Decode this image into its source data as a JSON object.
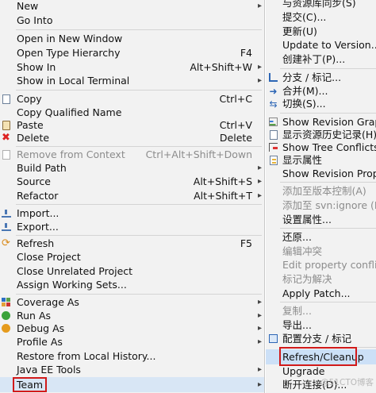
{
  "main_menu": {
    "items": [
      {
        "label": "New",
        "accel": "",
        "submenu": true,
        "icon": "",
        "disabled": false
      },
      {
        "label": "Go Into",
        "accel": "",
        "submenu": false,
        "icon": "",
        "disabled": false
      },
      {
        "label": "Open in New Window",
        "accel": "",
        "submenu": false,
        "icon": "",
        "disabled": false
      },
      {
        "label": "Open Type Hierarchy",
        "accel": "F4",
        "submenu": false,
        "icon": "",
        "disabled": false
      },
      {
        "label": "Show In",
        "accel": "Alt+Shift+W",
        "submenu": true,
        "icon": "",
        "disabled": false
      },
      {
        "label": "Show in Local Terminal",
        "accel": "",
        "submenu": true,
        "icon": "",
        "disabled": false
      },
      {
        "label": "Copy",
        "accel": "Ctrl+C",
        "submenu": false,
        "icon": "copy-icon",
        "disabled": false
      },
      {
        "label": "Copy Qualified Name",
        "accel": "",
        "submenu": false,
        "icon": "",
        "disabled": false
      },
      {
        "label": "Paste",
        "accel": "Ctrl+V",
        "submenu": false,
        "icon": "paste-icon",
        "disabled": false
      },
      {
        "label": "Delete",
        "accel": "Delete",
        "submenu": false,
        "icon": "delete-icon",
        "disabled": false
      },
      {
        "label": "Remove from Context",
        "accel": "Ctrl+Alt+Shift+Down",
        "submenu": false,
        "icon": "remove-context-icon",
        "disabled": true
      },
      {
        "label": "Build Path",
        "accel": "",
        "submenu": true,
        "icon": "",
        "disabled": false
      },
      {
        "label": "Source",
        "accel": "Alt+Shift+S",
        "submenu": true,
        "icon": "",
        "disabled": false
      },
      {
        "label": "Refactor",
        "accel": "Alt+Shift+T",
        "submenu": true,
        "icon": "",
        "disabled": false
      },
      {
        "label": "Import...",
        "accel": "",
        "submenu": false,
        "icon": "import-icon",
        "disabled": false
      },
      {
        "label": "Export...",
        "accel": "",
        "submenu": false,
        "icon": "export-icon",
        "disabled": false
      },
      {
        "label": "Refresh",
        "accel": "F5",
        "submenu": false,
        "icon": "refresh-icon",
        "disabled": false
      },
      {
        "label": "Close Project",
        "accel": "",
        "submenu": false,
        "icon": "",
        "disabled": false
      },
      {
        "label": "Close Unrelated Project",
        "accel": "",
        "submenu": false,
        "icon": "",
        "disabled": false
      },
      {
        "label": "Assign Working Sets...",
        "accel": "",
        "submenu": false,
        "icon": "",
        "disabled": false
      },
      {
        "label": "Coverage As",
        "accel": "",
        "submenu": true,
        "icon": "coverage-icon",
        "disabled": false
      },
      {
        "label": "Run As",
        "accel": "",
        "submenu": true,
        "icon": "run-icon",
        "disabled": false
      },
      {
        "label": "Debug As",
        "accel": "",
        "submenu": true,
        "icon": "debug-icon",
        "disabled": false
      },
      {
        "label": "Profile As",
        "accel": "",
        "submenu": true,
        "icon": "",
        "disabled": false
      },
      {
        "label": "Restore from Local History...",
        "accel": "",
        "submenu": false,
        "icon": "",
        "disabled": false
      },
      {
        "label": "Java EE Tools",
        "accel": "",
        "submenu": true,
        "icon": "",
        "disabled": false
      },
      {
        "label": "Team",
        "accel": "",
        "submenu": true,
        "icon": "",
        "disabled": false
      }
    ]
  },
  "team_submenu": {
    "items": [
      {
        "label": "与资源库同步(S)",
        "submenu": false,
        "icon": "",
        "disabled": false
      },
      {
        "label": "提交(C)...",
        "submenu": false,
        "icon": "",
        "disabled": false
      },
      {
        "label": "更新(U)",
        "submenu": false,
        "icon": "",
        "disabled": false
      },
      {
        "label": "Update to Version...",
        "submenu": false,
        "icon": "",
        "disabled": false
      },
      {
        "label": "创建补丁(P)...",
        "submenu": false,
        "icon": "",
        "disabled": false
      },
      {
        "label": "分支 / 标记...",
        "submenu": false,
        "icon": "branch-icon",
        "disabled": false
      },
      {
        "label": "合并(M)...",
        "submenu": false,
        "icon": "merge-icon",
        "disabled": false
      },
      {
        "label": "切换(S)...",
        "submenu": false,
        "icon": "switch-icon",
        "disabled": false
      },
      {
        "label": "Show Revision Graph",
        "submenu": false,
        "icon": "revision-graph-icon",
        "disabled": false
      },
      {
        "label": "显示资源历史记录(H)",
        "submenu": false,
        "icon": "history-icon",
        "disabled": false
      },
      {
        "label": "Show Tree Conflicts",
        "submenu": false,
        "icon": "tree-conflicts-icon",
        "disabled": false
      },
      {
        "label": "显示属性",
        "submenu": false,
        "icon": "properties-icon",
        "disabled": false
      },
      {
        "label": "Show Revision Proper",
        "submenu": false,
        "icon": "",
        "disabled": false
      },
      {
        "label": "添加至版本控制(A)",
        "submenu": false,
        "icon": "",
        "disabled": true
      },
      {
        "label": "添加至 svn:ignore (D)",
        "submenu": false,
        "icon": "",
        "disabled": true
      },
      {
        "label": "设置属性...",
        "submenu": false,
        "icon": "",
        "disabled": false
      },
      {
        "label": "还原...",
        "submenu": false,
        "icon": "",
        "disabled": false
      },
      {
        "label": "编辑冲突",
        "submenu": false,
        "icon": "",
        "disabled": true
      },
      {
        "label": "Edit property conflicts",
        "submenu": false,
        "icon": "",
        "disabled": true
      },
      {
        "label": "标记为解决",
        "submenu": false,
        "icon": "",
        "disabled": true
      },
      {
        "label": "Apply Patch...",
        "submenu": false,
        "icon": "",
        "disabled": false
      },
      {
        "label": "复制...",
        "submenu": false,
        "icon": "",
        "disabled": true
      },
      {
        "label": "导出...",
        "submenu": false,
        "icon": "",
        "disabled": false
      },
      {
        "label": "配置分支 / 标记",
        "submenu": false,
        "icon": "configure-branch-icon",
        "disabled": false
      },
      {
        "label": "Refresh/Cleanup",
        "submenu": false,
        "icon": "",
        "disabled": false
      },
      {
        "label": "Upgrade",
        "submenu": false,
        "icon": "",
        "disabled": false
      },
      {
        "label": "断开连接(D)...",
        "submenu": false,
        "icon": "",
        "disabled": false
      }
    ]
  },
  "watermark": "@51CTO博客",
  "colors": {
    "menu_bg": "#f2f2f2",
    "highlight_box": "#d11a1a",
    "disabled_text": "#8c8c8c",
    "hover_bg": "#d8e6f5"
  }
}
